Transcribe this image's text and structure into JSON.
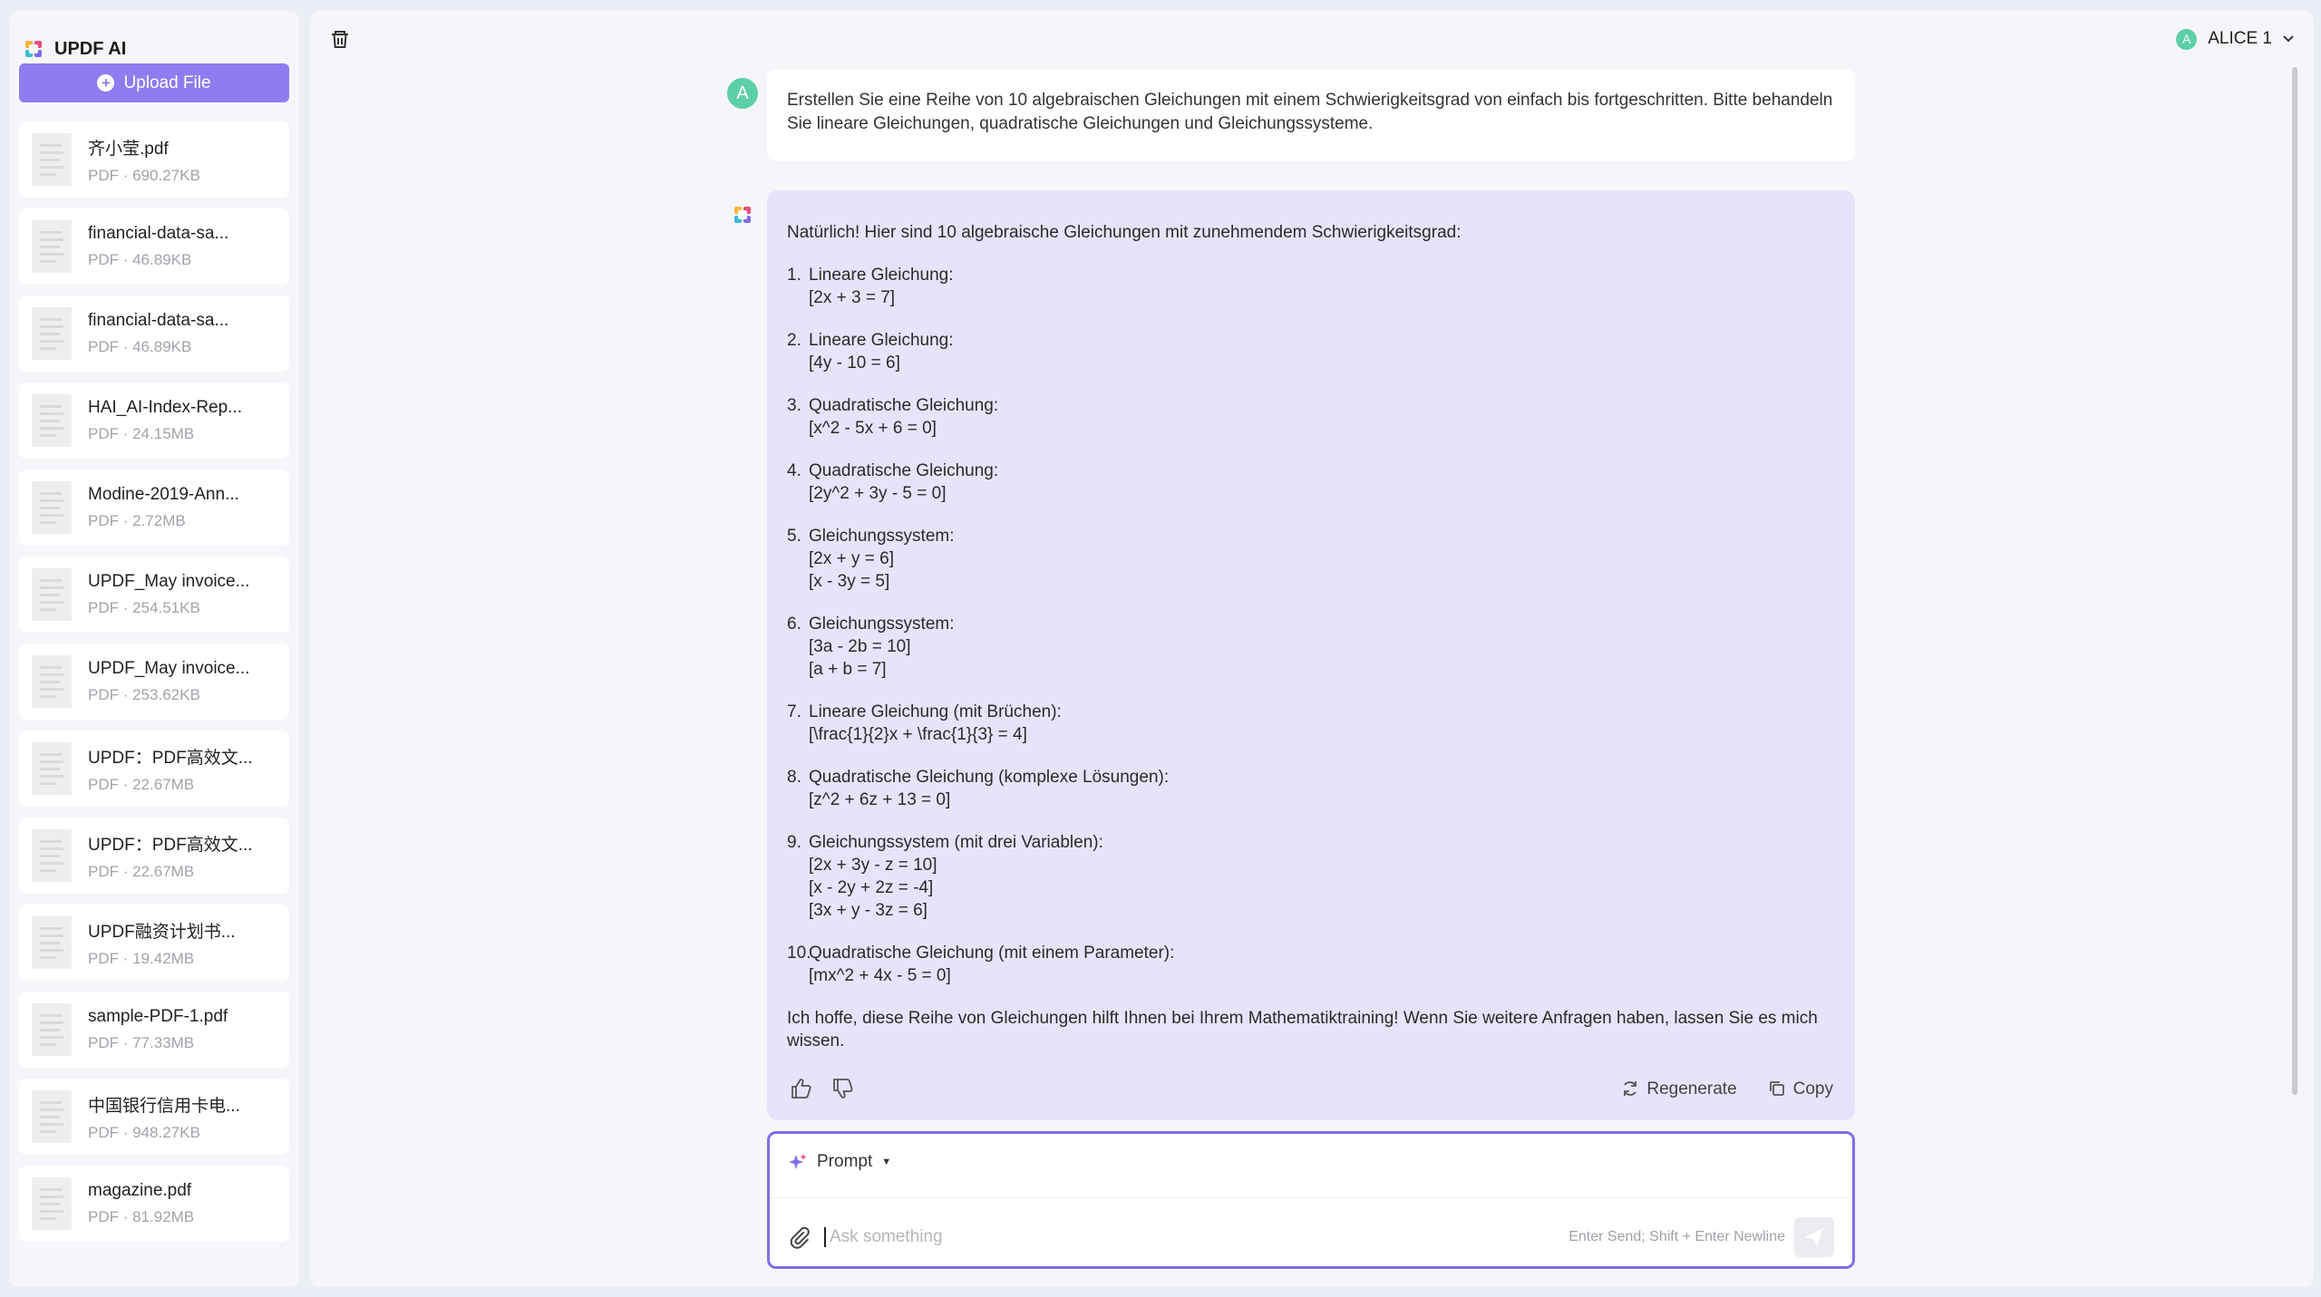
{
  "app": {
    "name": "UPDF AI"
  },
  "sidebar": {
    "upload_label": "Upload File",
    "files": [
      {
        "name": "齐小莹.pdf",
        "meta": "PDF · 690.27KB"
      },
      {
        "name": "financial-data-sa...",
        "meta": "PDF · 46.89KB"
      },
      {
        "name": "financial-data-sa...",
        "meta": "PDF · 46.89KB"
      },
      {
        "name": "HAI_AI-Index-Rep...",
        "meta": "PDF · 24.15MB"
      },
      {
        "name": "Modine-2019-Ann...",
        "meta": "PDF · 2.72MB"
      },
      {
        "name": "UPDF_May invoice...",
        "meta": "PDF · 254.51KB"
      },
      {
        "name": "UPDF_May invoice...",
        "meta": "PDF · 253.62KB"
      },
      {
        "name": "UPDF：PDF高效文...",
        "meta": "PDF · 22.67MB"
      },
      {
        "name": "UPDF：PDF高效文...",
        "meta": "PDF · 22.67MB"
      },
      {
        "name": "UPDF融资计划书...",
        "meta": "PDF · 19.42MB"
      },
      {
        "name": "sample-PDF-1.pdf",
        "meta": "PDF · 77.33MB"
      },
      {
        "name": "中国银行信用卡电...",
        "meta": "PDF · 948.27KB"
      },
      {
        "name": "magazine.pdf",
        "meta": "PDF · 81.92MB"
      }
    ]
  },
  "header": {
    "user_name": "ALICE 1",
    "user_initial": "A"
  },
  "chat": {
    "user_initial": "A",
    "user_message": "Erstellen Sie eine Reihe von 10 algebraischen Gleichungen mit einem Schwierigkeitsgrad von einfach bis fortgeschritten. Bitte behandeln Sie lineare Gleichungen, quadratische Gleichungen und Gleichungssysteme.",
    "ai_intro": "Natürlich! Hier sind 10 algebraische Gleichungen mit zunehmendem Schwierigkeitsgrad:",
    "equations": [
      {
        "num": "1.",
        "title": "Lineare Gleichung:",
        "lines": [
          "[2x + 3 = 7]"
        ]
      },
      {
        "num": "2.",
        "title": "Lineare Gleichung:",
        "lines": [
          "[4y - 10 = 6]"
        ]
      },
      {
        "num": "3.",
        "title": "Quadratische Gleichung:",
        "lines": [
          "[x^2 - 5x + 6 = 0]"
        ]
      },
      {
        "num": "4.",
        "title": "Quadratische Gleichung:",
        "lines": [
          "[2y^2 + 3y - 5 = 0]"
        ]
      },
      {
        "num": "5.",
        "title": "Gleichungssystem:",
        "lines": [
          "[2x + y = 6]",
          "[x - 3y = 5]"
        ]
      },
      {
        "num": "6.",
        "title": "Gleichungssystem:",
        "lines": [
          "[3a - 2b = 10]",
          "[a + b = 7]"
        ]
      },
      {
        "num": "7.",
        "title": "Lineare Gleichung (mit Brüchen):",
        "lines": [
          "[\\frac{1}{2}x + \\frac{1}{3} = 4]"
        ]
      },
      {
        "num": "8.",
        "title": "Quadratische Gleichung (komplexe Lösungen):",
        "lines": [
          "[z^2 + 6z + 13 = 0]"
        ]
      },
      {
        "num": "9.",
        "title": "Gleichungssystem (mit drei Variablen):",
        "lines": [
          "[2x + 3y - z = 10]",
          "[x - 2y + 2z = -4]",
          "[3x + y - 3z = 6]"
        ]
      },
      {
        "num": "10.",
        "title": "Quadratische Gleichung (mit einem Parameter):",
        "lines": [
          "[mx^2 + 4x - 5 = 0]"
        ]
      }
    ],
    "ai_outro": "Ich hoffe, diese Reihe von Gleichungen hilft Ihnen bei Ihrem Mathematiktraining! Wenn Sie weitere Anfragen haben, lassen Sie es mich wissen.",
    "regenerate_label": "Regenerate",
    "copy_label": "Copy"
  },
  "composer": {
    "prompt_label": "Prompt",
    "placeholder": "Ask something",
    "hint": "Enter Send; Shift + Enter Newline"
  },
  "colors": {
    "accent": "#8f7cf0",
    "ai_bubble": "#e6e4fb",
    "avatar": "#5ccfa6"
  }
}
